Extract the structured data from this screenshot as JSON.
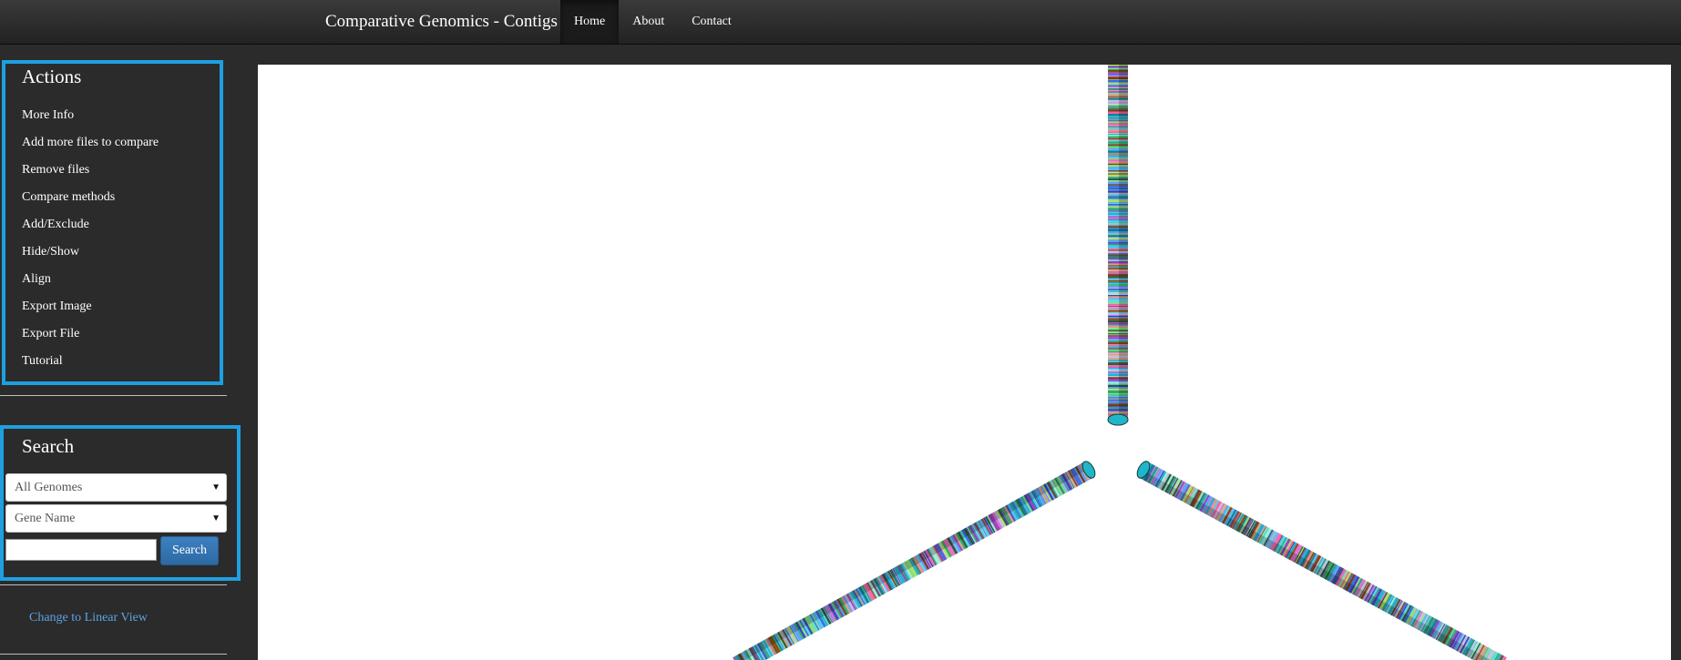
{
  "navbar": {
    "brand": "Comparative Genomics - Contigs",
    "items": [
      {
        "label": "Home",
        "active": true
      },
      {
        "label": "About",
        "active": false
      },
      {
        "label": "Contact",
        "active": false
      }
    ]
  },
  "sidebar": {
    "actions": {
      "title": "Actions",
      "items": [
        "More Info",
        "Add more files to compare",
        "Remove files",
        "Compare methods",
        "Add/Exclude",
        "Hide/Show",
        "Align",
        "Export Image",
        "Export File",
        "Tutorial"
      ]
    },
    "search": {
      "title": "Search",
      "genome_select": "All Genomes",
      "field_select": "Gene Name",
      "input_value": "",
      "button_label": "Search"
    },
    "linear_view_link": "Change to Linear View"
  },
  "colors": {
    "highlight_border": "#1ea0e0",
    "search_button": "#337ab7",
    "link": "#5aa3e6",
    "contig_palette": [
      "#1fb6c9",
      "#8b4a12",
      "#27b46a",
      "#3a6ee0",
      "#9b3fbf",
      "#5bd8e8",
      "#c0c0e8",
      "#2a9e8c",
      "#7fe08a",
      "#e070d0",
      "#4040c0",
      "#b0e060",
      "#0f7f9a",
      "#d8a080",
      "#60a0ff",
      "#2c5a3a",
      "#a0f0d0",
      "#ff60a0",
      "#50c0ff",
      "#7a3a20"
    ]
  },
  "icons": {
    "select_caret": "▼"
  }
}
